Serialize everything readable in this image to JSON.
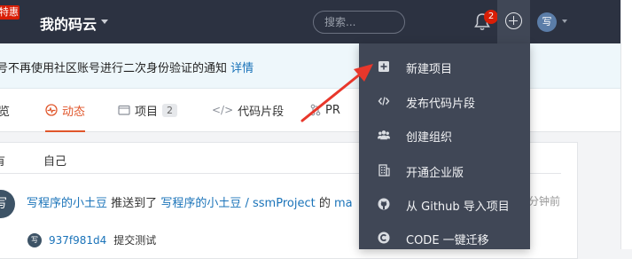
{
  "header": {
    "promo_badge": "特惠",
    "brand": "我的码云",
    "search_placeholder": "搜索...",
    "notification_count": "2",
    "user_avatar_char": "写"
  },
  "notice": {
    "text": "号不再使用社区账号进行二次身份验证的通知",
    "link": "详情"
  },
  "tabs": {
    "overview": "览",
    "activity": "动态",
    "projects": "项目",
    "projects_count": "2",
    "snippets": "代码片段",
    "pr": "PR"
  },
  "feed": {
    "subtab_all": "有",
    "subtab_mine": "自己",
    "avatar_char": "写",
    "actor": "写程序的小土豆",
    "action": "推送到了",
    "repo_owner": "写程序的小土豆",
    "repo_sep": "/",
    "repo_name": "ssmProject",
    "of": "的",
    "branch": "ma",
    "time": "分钟前",
    "commit_avatar_char": "写",
    "commit_hash": "937f981d4",
    "commit_message": "提交测试"
  },
  "dropdown": {
    "items": [
      {
        "label": "新建项目",
        "icon": "plus-square-icon"
      },
      {
        "label": "发布代码片段",
        "icon": "code-icon"
      },
      {
        "label": "创建组织",
        "icon": "group-icon"
      },
      {
        "label": "开通企业版",
        "icon": "building-icon"
      },
      {
        "label": "从 Github 导入项目",
        "icon": "github-icon"
      },
      {
        "label": "CODE 一键迁移",
        "icon": "code-migrate-icon"
      }
    ]
  },
  "colors": {
    "nav_bg": "#2c3241",
    "dropdown_bg": "#404756",
    "accent": "#e0562b",
    "link": "#1a73b9",
    "badge_red": "#d81e06",
    "arrow_red": "#e8372b"
  }
}
